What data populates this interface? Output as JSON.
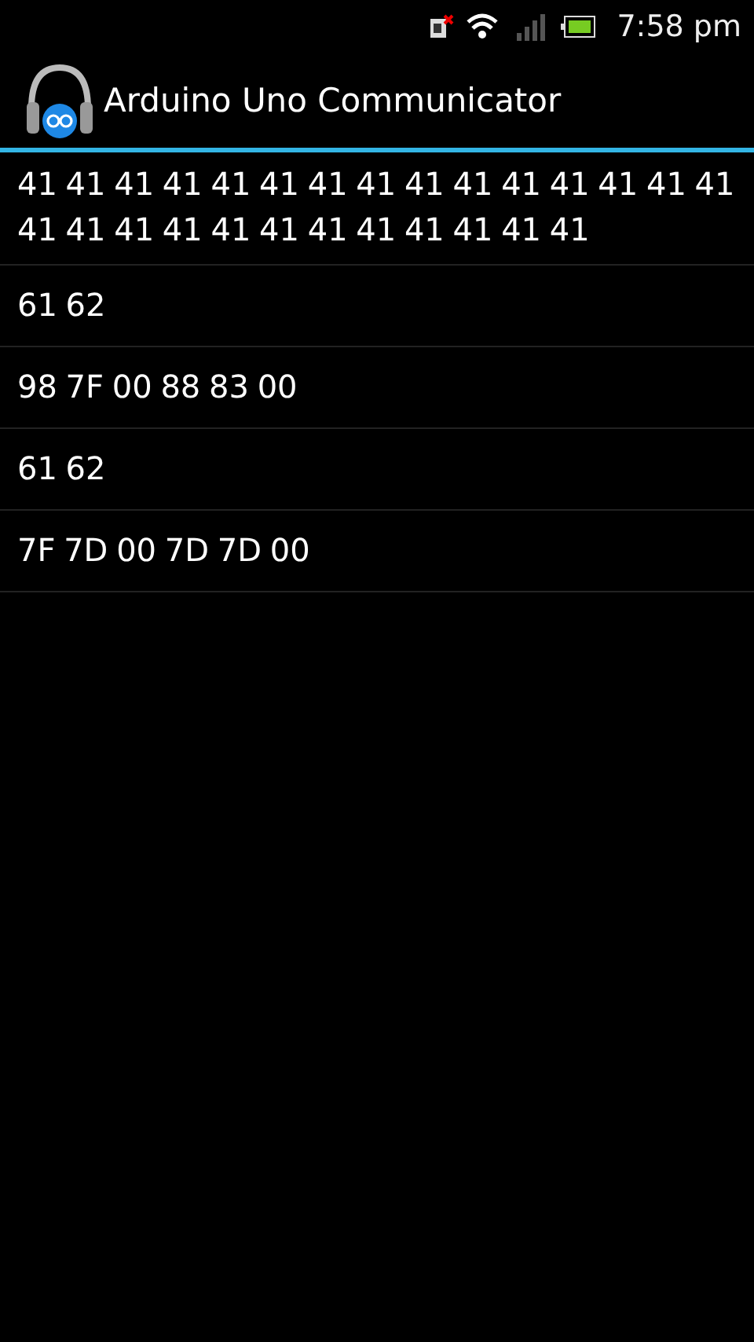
{
  "status_bar": {
    "time": "7:58 pm"
  },
  "app_bar": {
    "title": "Arduino Uno Communicator"
  },
  "messages": [
    {
      "text": "41 41 41 41 41 41 41 41 41 41 41 41 41 41 41 41 41 41 41 41 41 41 41 41 41 41 41"
    },
    {
      "text": "61 62"
    },
    {
      "text": "98 7F 00 88 83 00"
    },
    {
      "text": "61 62"
    },
    {
      "text": "7F 7D 00 7D 7D 00"
    }
  ]
}
